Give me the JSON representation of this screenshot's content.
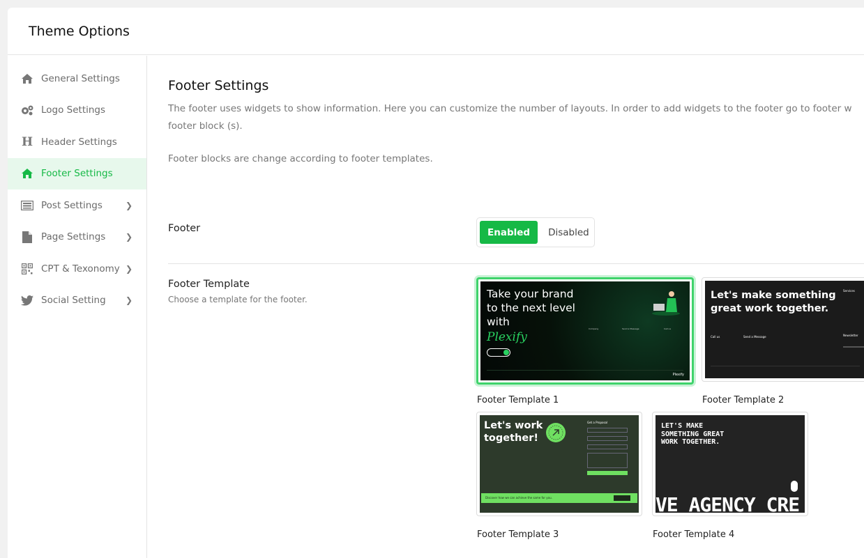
{
  "app": {
    "title": "Theme Options"
  },
  "sidebar": {
    "items": [
      {
        "label": "General Settings",
        "icon": "home-icon",
        "active": false,
        "has_submenu": false
      },
      {
        "label": "Logo Settings",
        "icon": "gears-icon",
        "active": false,
        "has_submenu": false
      },
      {
        "label": "Header Settings",
        "icon": "heading-icon",
        "active": false,
        "has_submenu": false
      },
      {
        "label": "Footer Settings",
        "icon": "home-icon",
        "active": true,
        "has_submenu": false
      },
      {
        "label": "Post Settings",
        "icon": "list-alt-icon",
        "active": false,
        "has_submenu": true
      },
      {
        "label": "Page Settings",
        "icon": "file-icon",
        "active": false,
        "has_submenu": true
      },
      {
        "label": "CPT & Texonomy",
        "icon": "qrcode-icon",
        "active": false,
        "has_submenu": true
      },
      {
        "label": "Social Setting",
        "icon": "twitter-icon",
        "active": false,
        "has_submenu": true
      }
    ]
  },
  "main": {
    "title": "Footer Settings",
    "description_line1": "The footer uses widgets to show information. Here you can customize the number of layouts. In order to add widgets to the footer go to footer w",
    "description_line2": "footer block (s).",
    "description_note": "Footer blocks are change according to footer templates.",
    "footer_toggle": {
      "label": "Footer",
      "options": [
        "Enabled",
        "Disabled"
      ],
      "selected": "Enabled"
    },
    "template_picker": {
      "label": "Footer Template",
      "hint": "Choose a template for the footer.",
      "selected": "Footer Template 1",
      "templates": [
        {
          "caption": "Footer Template 1"
        },
        {
          "caption": "Footer Template 2"
        },
        {
          "caption": "Footer Template 3"
        },
        {
          "caption": "Footer Template 4"
        }
      ]
    },
    "previews": {
      "t1": {
        "headline": "Take your brand to the next level with",
        "brand": "Plexify",
        "col1": "Company",
        "col2": "Send a Message",
        "col3": "Call us",
        "footer_logo": "Plexify"
      },
      "t2": {
        "headline": "Let's make something great work together.",
        "col1": "Call us",
        "col2": "Send a Message",
        "side1": "Services",
        "side2": "Newsletter"
      },
      "t3": {
        "headline": "Let's work together!",
        "form_title": "Get a Proposal",
        "banner": "Discover how we can achieve the same for you."
      },
      "t4": {
        "headline": "LET'S MAKE SOMETHING GREAT WORK TOGETHER.",
        "marquee": "VE AGENCY CRE"
      }
    }
  },
  "colors": {
    "accent": "#16b946",
    "accent_bg": "#e7f8ec",
    "selected_border": "#3fd36b"
  }
}
